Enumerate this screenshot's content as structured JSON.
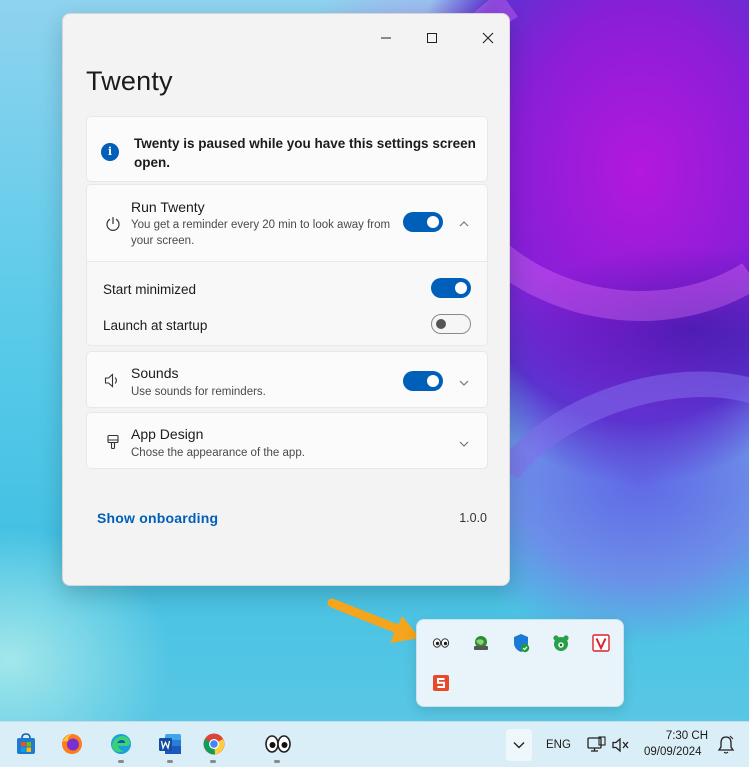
{
  "window": {
    "title": "Twenty",
    "controls": {
      "minimize": "minimize",
      "maximize": "maximize",
      "close": "close"
    }
  },
  "info_banner": {
    "text": "Twenty is paused while you have this settings screen open."
  },
  "settings": {
    "run_twenty": {
      "title": "Run Twenty",
      "description": "You get a reminder every 20 min to look away from your screen.",
      "enabled": true
    },
    "start_minimized": {
      "label": "Start minimized",
      "enabled": true
    },
    "launch_at_startup": {
      "label": "Launch at startup",
      "enabled": false
    },
    "sounds": {
      "title": "Sounds",
      "description": "Use sounds for reminders.",
      "enabled": true
    },
    "app_design": {
      "title": "App Design",
      "description": "Chose the appearance of the app."
    }
  },
  "footer": {
    "onboarding_link": "Show onboarding",
    "version": "1.0.0"
  },
  "tray_flyout": {
    "icons": [
      "twenty-eyes-icon",
      "network-globe-icon",
      "defender-shield-icon",
      "green-bear-icon",
      "red-v-icon",
      "red-s-icon"
    ]
  },
  "taskbar": {
    "apps": [
      "microsoft-store-icon",
      "firefox-icon",
      "edge-icon",
      "word-icon",
      "chrome-icon",
      "twenty-eyes-icon"
    ],
    "language": "ENG",
    "time": "7:30 CH",
    "date": "09/09/2024"
  },
  "colors": {
    "accent": "#005fb8",
    "window_bg": "#f3f3f3",
    "arrow": "#f4a51c"
  }
}
